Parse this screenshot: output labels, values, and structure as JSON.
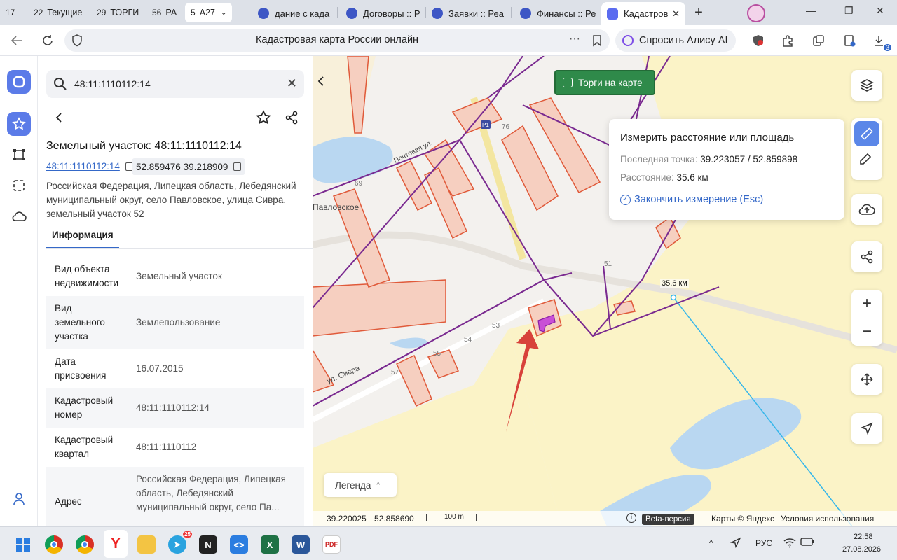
{
  "browser": {
    "tab_groups": [
      {
        "count": "17",
        "label": ""
      },
      {
        "count": "22",
        "label": "Текущие"
      },
      {
        "count": "29",
        "label": "ТОРГИ"
      },
      {
        "count": "56",
        "label": "РА"
      },
      {
        "count": "5",
        "label": "А27"
      }
    ],
    "tabs": [
      {
        "label": "дание с када",
        "color": "#4a5bd0"
      },
      {
        "label": "Договоры :: Р",
        "color": "#4a5bd0"
      },
      {
        "label": "Заявки :: Реа",
        "color": "#4a5bd0"
      },
      {
        "label": "Финансы :: Ре",
        "color": "#4a5bd0"
      },
      {
        "label": "Кадастров",
        "color": "#5b6cf0",
        "active": true
      }
    ],
    "new_tab_symbol": "+",
    "page_title": "Кадастровая карта России онлайн",
    "menu_dots": "···",
    "alice_label": "Спросить Алису AI",
    "downloads_badge": "3"
  },
  "panel": {
    "search_value": "48:11:1110112:14",
    "object_title": "Земельный участок: 48:11:1110112:14",
    "cad_number_link": "48:11:1110112:14",
    "coordinates": "52.859476 39.218909",
    "address": "Российская Федерация, Липецкая область, Лебедянский муниципальный округ, село Павловское, улица Сивра, земельный участок 52",
    "info_tab": "Информация",
    "rows": [
      {
        "key": "Вид объекта недвижимости",
        "value": "Земельный участок"
      },
      {
        "key": "Вид земельного участка",
        "value": "Землепользование"
      },
      {
        "key": "Дата присвоения",
        "value": "16.07.2015"
      },
      {
        "key": "Кадастровый номер",
        "value": "48:11:1110112:14"
      },
      {
        "key": "Кадастровый квартал",
        "value": "48:11:1110112"
      },
      {
        "key": "Адрес",
        "value": "Российская Федерация, Липецкая область, Лебедянский муниципальный округ, село Па..."
      }
    ]
  },
  "map": {
    "torgi_label": "Торги на карте",
    "measure": {
      "title": "Измерить расстояние или площадь",
      "last_point_label": "Последняя точка:",
      "last_point_value": "39.223057 / 52.859898",
      "distance_label": "Расстояние:",
      "distance_value": "35.6 км",
      "finish_label": "Закончить измерение (Esc)"
    },
    "distance_marker": "35.6 км",
    "legend_label": "Легенда",
    "cursor_lon": "39.220025",
    "cursor_lat": "52.858690",
    "scale_label": "100 m",
    "beta_label": "Beta-версия",
    "copyright": "Карты © Яндекс",
    "terms": "Условия использования",
    "zoom_in": "+",
    "zoom_out": "−",
    "labels": {
      "village": "Павловское",
      "street_sivra": "ул. Сивра",
      "street_pochtovaya": "Почтовая ул.",
      "road_marker": "Р1",
      "house_69": "69",
      "house_51": "51",
      "house_53": "53",
      "house_54": "54",
      "house_55": "55",
      "house_57": "57",
      "house_76": "76"
    },
    "colors": {
      "parcel_fill": "#f6cfc0",
      "parcel_stroke": "#e05a3a",
      "boundary": "#7a2a90",
      "field": "#fbf3c7",
      "water": "#b9d7f1",
      "measure_line": "#35b6ea",
      "arrow": "#d8413a",
      "selected": "#c94fd6"
    }
  },
  "taskbar": {
    "lang": "РУС",
    "time": "22:58",
    "date": "27.08.2026",
    "telegram_badge": "25"
  }
}
